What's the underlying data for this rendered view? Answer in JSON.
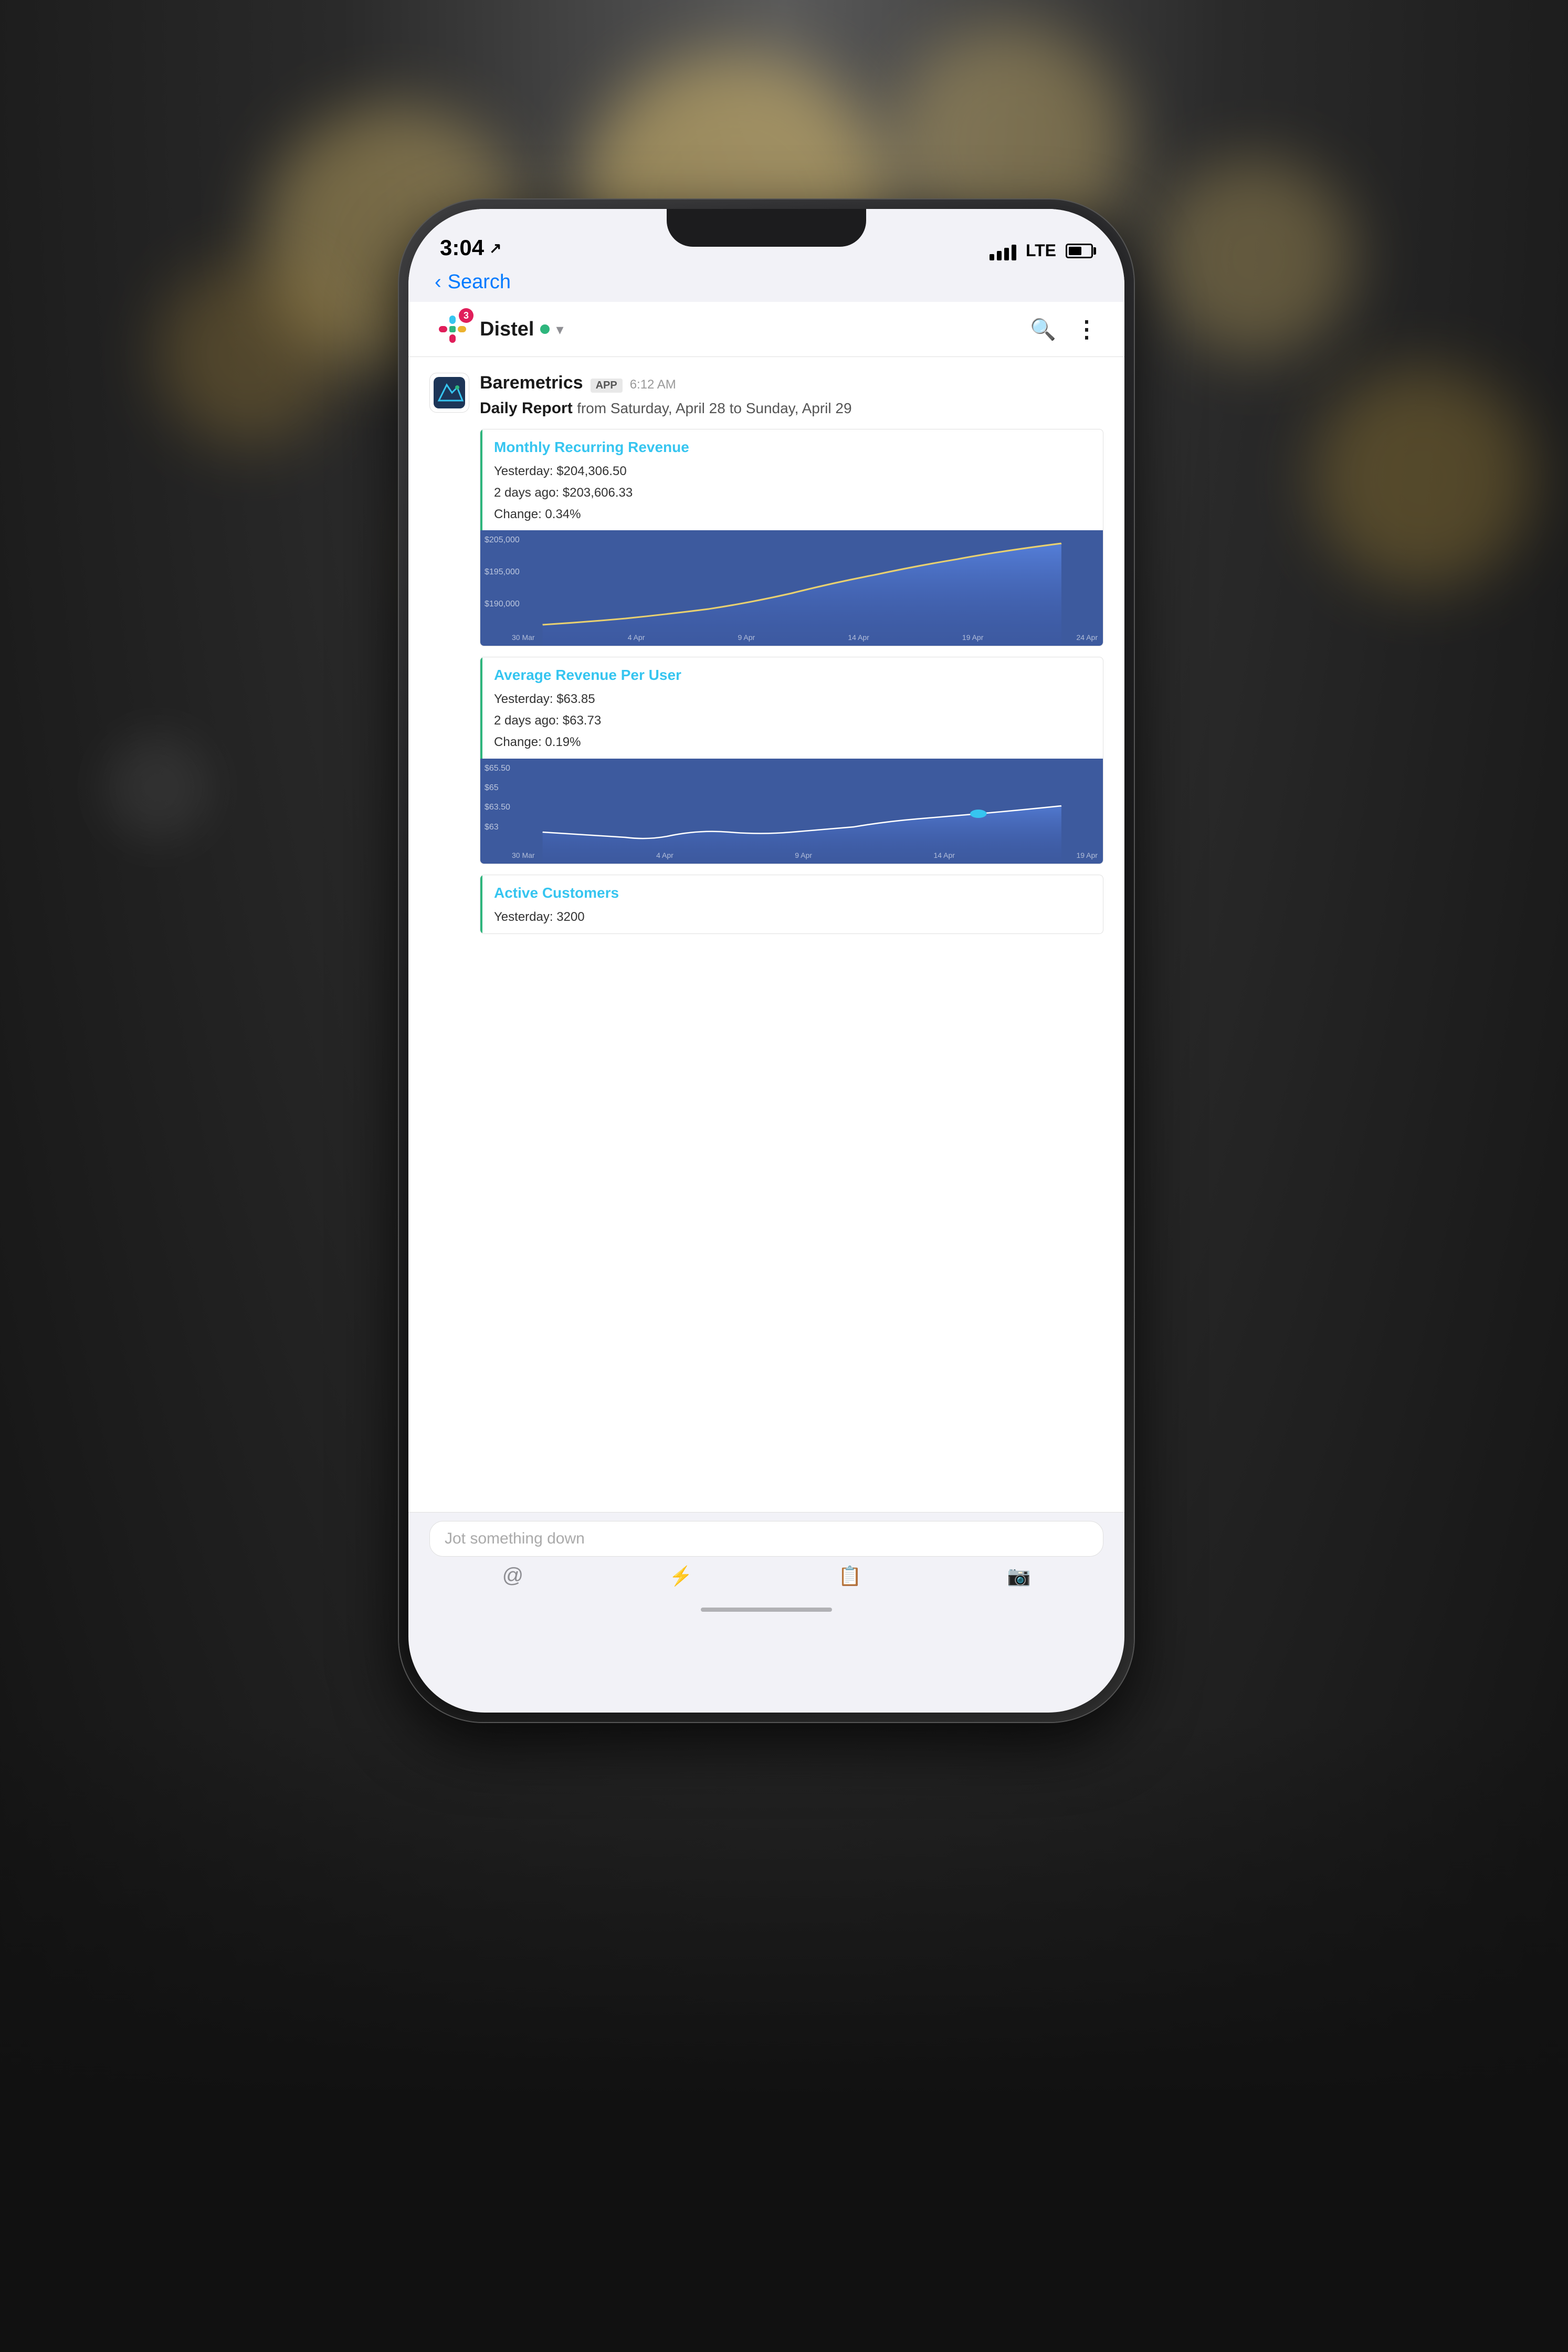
{
  "background": {
    "color": "#1a1212"
  },
  "statusBar": {
    "time": "3:04",
    "locationArrow": "↗",
    "signal": "●●●",
    "networkType": "LTE",
    "battery": 60
  },
  "backNav": {
    "backLabel": "Search"
  },
  "channelHeader": {
    "channelName": "Distel",
    "notificationCount": "3",
    "status": "online"
  },
  "botMessage": {
    "botName": "Baremetrics",
    "appBadge": "APP",
    "time": "6:12 AM",
    "dailyReportLabel": "Daily Report",
    "dailyReportSub": "from Saturday, April 28 to Sunday, April 29",
    "metrics": [
      {
        "title": "Monthly Recurring Revenue",
        "yesterday": "$204,306.50",
        "twoDaysAgo": "$203,606.33",
        "change": "0.34%",
        "chartYLabels": [
          "$205,000",
          "$195,000",
          "$190,000"
        ],
        "chartXLabels": [
          "30 Mar",
          "4 Apr",
          "9 Apr",
          "14 Apr",
          "19 Apr",
          "24 Apr"
        ]
      },
      {
        "title": "Average Revenue Per User",
        "yesterday": "$63.85",
        "twoDaysAgo": "$63.73",
        "change": "0.19%",
        "chartYLabels": [
          "$65.50",
          "$65",
          "$63.50",
          "$63"
        ],
        "chartXLabels": [
          "30 Mar",
          "4 Apr",
          "9 Apr",
          "14 Apr",
          "19 Apr"
        ]
      },
      {
        "title": "Active Customers",
        "yesterday": "3200",
        "twoDaysAgo": "",
        "change": "",
        "chartYLabels": [],
        "chartXLabels": []
      }
    ]
  },
  "inputBar": {
    "placeholder": "Jot something down",
    "icons": [
      "@",
      "⚡",
      "📋",
      "📷"
    ]
  },
  "labels": {
    "yesterday": "Yesterday:",
    "twoDaysAgo": "2 days ago:",
    "change": "Change:"
  }
}
